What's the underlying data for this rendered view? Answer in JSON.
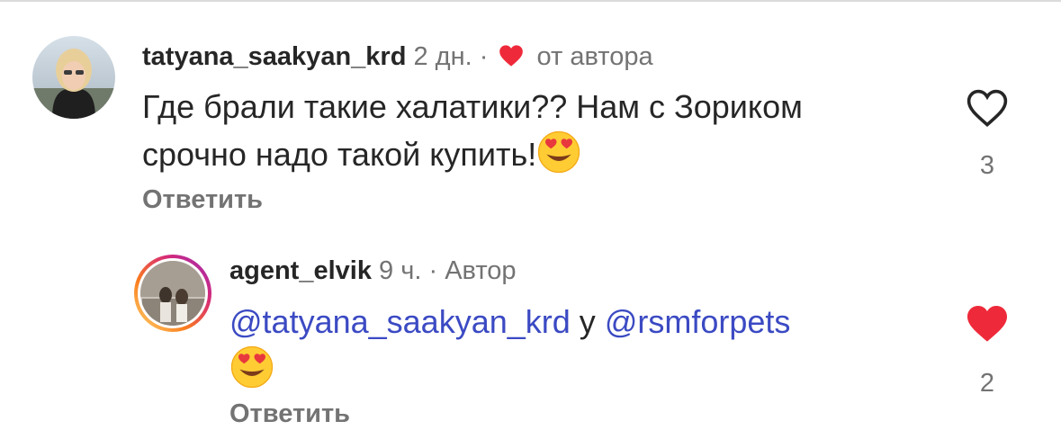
{
  "comments": [
    {
      "username": "tatyana_saakyan_krd",
      "time": "2 дн.",
      "separator": "·",
      "author_like_label": "от автора",
      "text_line1": "Где брали такие халатики?? Нам с Зориком",
      "text_line2": "срочно надо такой купить!",
      "emoji": "heart-eyes-emoji",
      "reply_label": "Ответить",
      "like_count": "3",
      "liked": false
    },
    {
      "username": "agent_elvik",
      "time": "9 ч.",
      "separator": "·",
      "author_badge": "Автор",
      "mention1": "@tatyana_saakyan_krd",
      "connector": "у",
      "mention2": "@rsmforpets",
      "emoji": "heart-eyes-emoji",
      "reply_label": "Ответить",
      "like_count": "2",
      "liked": true
    }
  ],
  "colors": {
    "heart_red": "#ee2a3a",
    "mention_blue": "#3b4ac3",
    "muted_gray": "#737373",
    "story_ring": [
      "#feda75",
      "#fa7e1e",
      "#d62976",
      "#962fbf"
    ]
  },
  "icons": {
    "heart_outline": "heart-outline-icon",
    "heart_filled": "heart-filled-icon"
  }
}
